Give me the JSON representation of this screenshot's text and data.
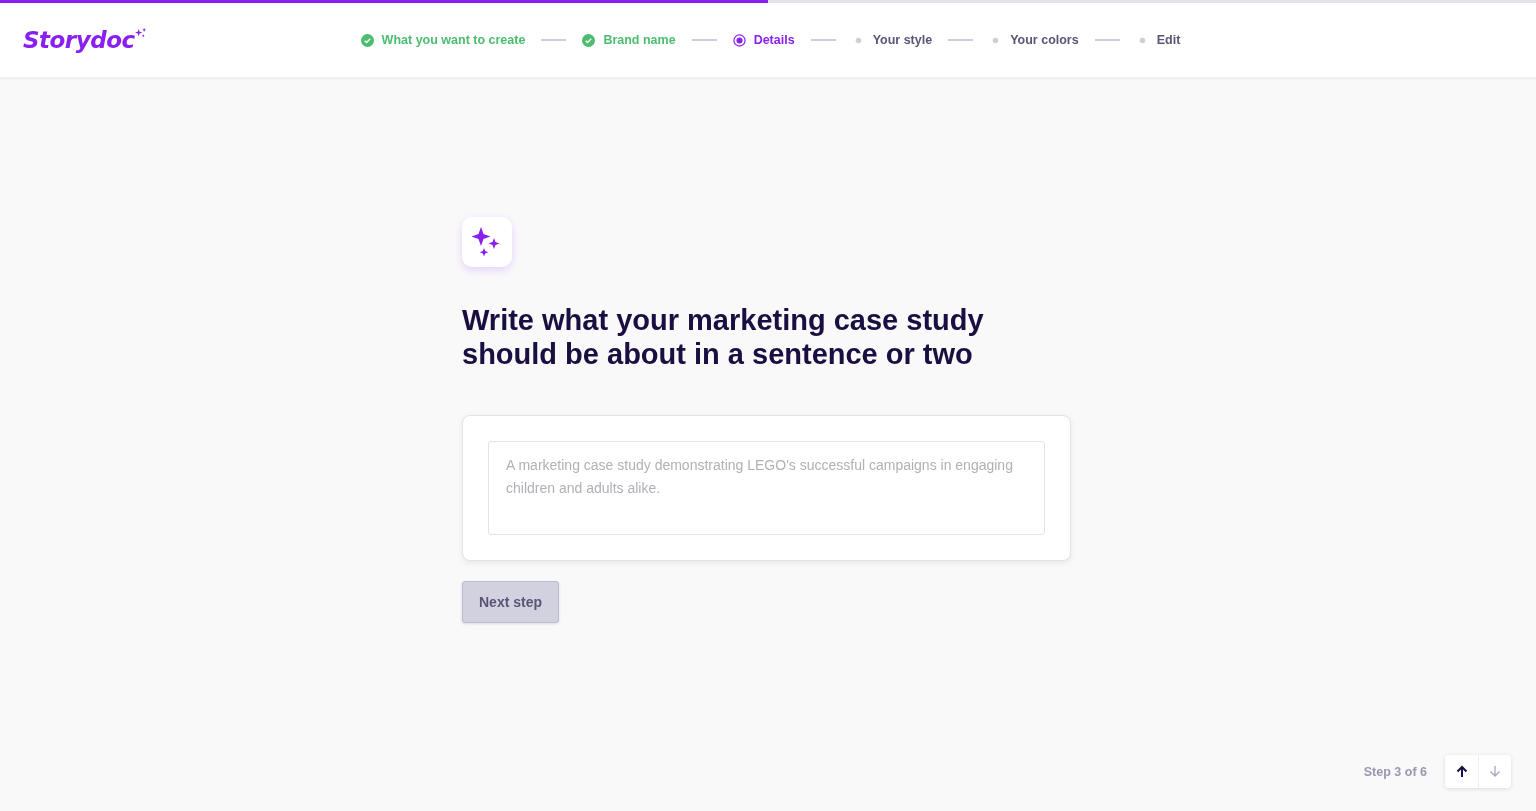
{
  "progress": {
    "level": 0.5
  },
  "logo": "Storydoc",
  "steps": [
    {
      "label": "What you want to create",
      "kind": "done"
    },
    {
      "label": "Brand name",
      "kind": "done"
    },
    {
      "label": "Details",
      "kind": "current"
    },
    {
      "label": "Your style",
      "kind": "upcoming"
    },
    {
      "label": "Your colors",
      "kind": "upcoming"
    },
    {
      "label": "Edit",
      "kind": "upcoming"
    }
  ],
  "heading": "Write what your marketing case study should be about in a sentence or two",
  "description_field": {
    "placeholder": "A marketing case study demonstrating LEGO's successful campaigns in engaging children and adults alike."
  },
  "next_button": {
    "label": "Next step",
    "disabled": true
  },
  "footer": {
    "step_counter": "Step 3 of 6",
    "up_disabled": false,
    "down_disabled": true
  }
}
